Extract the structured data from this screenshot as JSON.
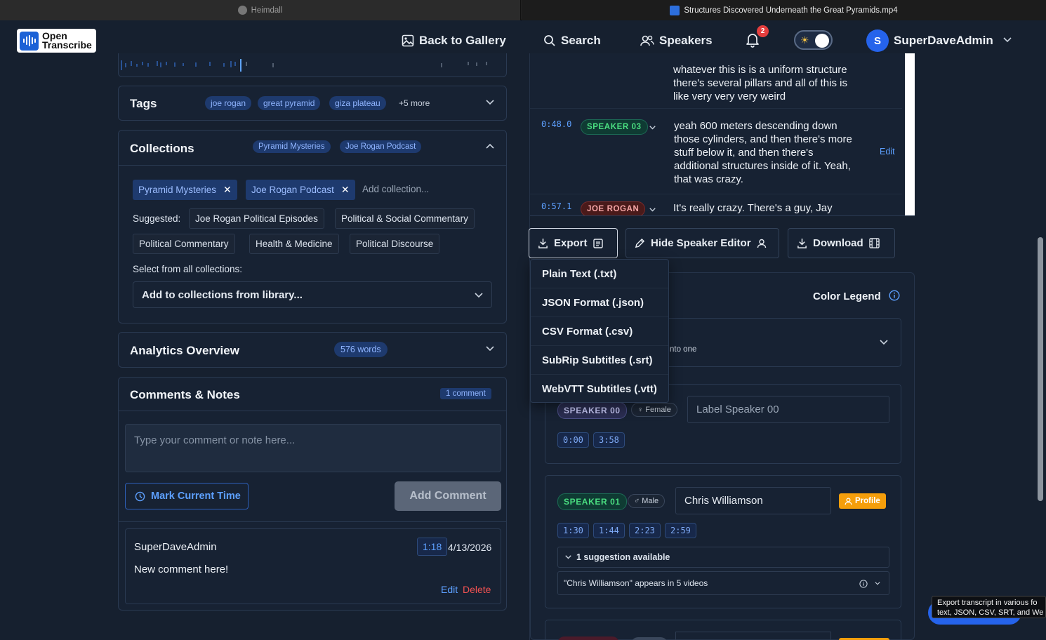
{
  "browser": {
    "tab1_title": "Heimdall",
    "tab2_title": "Structures Discovered Underneath the Great Pyramids.mp4"
  },
  "header": {
    "logo_line1": "Open",
    "logo_line2": "Transcribe",
    "back_label": "Back to Gallery",
    "search_label": "Search",
    "speakers_label": "Speakers",
    "notification_count": "2",
    "avatar_initial": "S",
    "username": "SuperDaveAdmin"
  },
  "tags": {
    "title": "Tags",
    "items": [
      "joe rogan",
      "great pyramid",
      "giza plateau"
    ],
    "more": "+5 more"
  },
  "collections": {
    "title": "Collections",
    "header_chips": [
      "Pyramid Mysteries",
      "Joe Rogan Podcast"
    ],
    "selected": [
      "Pyramid Mysteries",
      "Joe Rogan Podcast"
    ],
    "add_placeholder": "Add collection...",
    "suggested_label": "Suggested:",
    "suggested": [
      "Joe Rogan Political Episodes",
      "Political & Social Commentary",
      "Political Commentary",
      "Health & Medicine",
      "Political Discourse"
    ],
    "select_all_label": "Select from all collections:",
    "library_select": "Add to collections from library..."
  },
  "analytics": {
    "title": "Analytics Overview",
    "words": "576 words"
  },
  "comments": {
    "title": "Comments & Notes",
    "count": "1 comment",
    "placeholder": "Type your comment or note here...",
    "mark_time": "Mark Current Time",
    "add_comment": "Add Comment",
    "items": [
      {
        "author": "SuperDaveAdmin",
        "time": "1:18",
        "date": "4/13/2026",
        "text": "New comment here!",
        "edit": "Edit",
        "delete": "Delete"
      }
    ]
  },
  "transcript": {
    "partial_text": "whatever this is is a uniform structure there's several pillars and all of this is like very very very weird",
    "segments": [
      {
        "time": "0:48.0",
        "speaker": "SPEAKER 03",
        "text": "yeah 600 meters descending down those cylinders, and then there's more stuff below it, and then there's additional structures inside of it. Yeah, that was crazy.",
        "edit": "Edit"
      },
      {
        "time": "0:57.1",
        "speaker": "JOE ROGAN",
        "text": "It's really crazy. There's a guy, Jay"
      }
    ]
  },
  "toolbar": {
    "export": "Export",
    "hide_editor": "Hide Speaker Editor",
    "download": "Download"
  },
  "export_menu": [
    "Plain Text (.txt)",
    "JSON Format (.json)",
    "CSV Format (.csv)",
    "SubRip Subtitles (.srt)",
    "WebVTT Subtitles (.vtt)"
  ],
  "speaker_editor": {
    "color_legend": "Color Legend",
    "merge_hint_fragment": "nto one",
    "speakers": [
      {
        "id": "SPEAKER 00",
        "gender": "Female",
        "label_placeholder": "Label Speaker 00",
        "times": [
          "0:00",
          "3:58"
        ]
      },
      {
        "id": "SPEAKER 01",
        "gender": "Male",
        "name": "Chris Williamson",
        "profile": "Profile",
        "times": [
          "1:30",
          "1:44",
          "2:23",
          "2:59"
        ],
        "suggestion_toggle": "1 suggestion available",
        "suggestion_text": "\"Chris Williamson\" appears in 5 videos"
      }
    ]
  },
  "tooltip": {
    "line1": "Export transcript in various fo",
    "line2": "text, JSON, CSV, SRT, and We"
  }
}
